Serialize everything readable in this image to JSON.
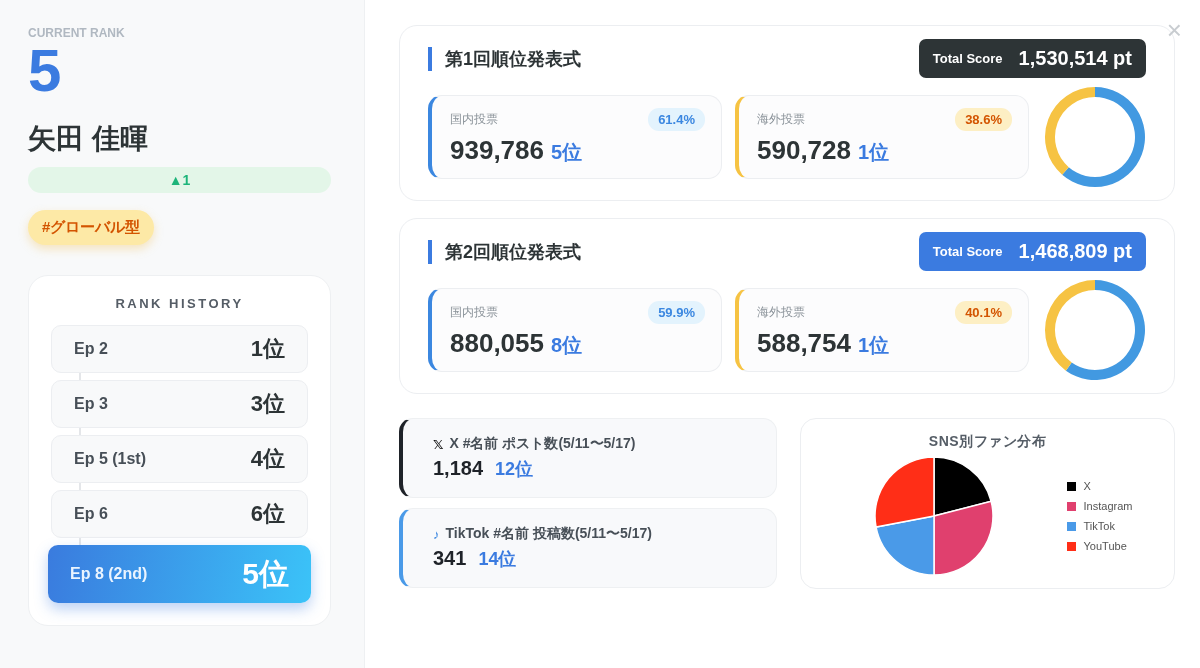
{
  "profile": {
    "label": "CURRENT RANK",
    "rank": "5",
    "name": "矢田 佳暉",
    "change": "▲1",
    "tag": "#グローバル型"
  },
  "history": {
    "title": "RANK HISTORY",
    "items": [
      {
        "episode": "Ep 2",
        "rank": "1位",
        "selected": false
      },
      {
        "episode": "Ep 3",
        "rank": "3位",
        "selected": false
      },
      {
        "episode": "Ep 5 (1st)",
        "rank": "4位",
        "selected": false
      },
      {
        "episode": "Ep 6",
        "rank": "6位",
        "selected": false
      },
      {
        "episode": "Ep 8 (2nd)",
        "rank": "5位",
        "selected": true
      }
    ]
  },
  "close": "×",
  "announcements": [
    {
      "title": "第1回順位発表式",
      "score": {
        "label": "Total Score",
        "value": "1,530,514 pt",
        "color": "#2d3436"
      },
      "votes": [
        {
          "kind": "domestic",
          "label": "国内投票",
          "share": "61.4%",
          "count": "939,786",
          "rank": "5位"
        },
        {
          "kind": "overseas",
          "label": "海外投票",
          "share": "38.6%",
          "count": "590,728",
          "rank": "1位"
        }
      ],
      "chart_data": {
        "type": "donut",
        "values": [
          61.4,
          38.6
        ]
      }
    },
    {
      "title": "第2回順位発表式",
      "score": {
        "label": "Total Score",
        "value": "1,468,809 pt",
        "color": "#3b7be0"
      },
      "votes": [
        {
          "kind": "domestic",
          "label": "国内投票",
          "share": "59.9%",
          "count": "880,055",
          "rank": "8位"
        },
        {
          "kind": "overseas",
          "label": "海外投票",
          "share": "40.1%",
          "count": "588,754",
          "rank": "1位"
        }
      ],
      "chart_data": {
        "type": "donut",
        "values": [
          59.9,
          40.1
        ]
      }
    }
  ],
  "sns_stats": [
    {
      "kind": "x",
      "icon": "𝕏",
      "label": "X #名前 ポスト数(5/11〜5/17)",
      "count": "1,184",
      "rank": "12位"
    },
    {
      "kind": "tiktok",
      "icon": "♪",
      "label": "TikTok #名前 投稿数(5/11〜5/17)",
      "count": "341",
      "rank": "14位"
    }
  ],
  "fan_distribution": {
    "title": "SNS別ファン分布",
    "legend": [
      {
        "label": "X",
        "color": "#000000"
      },
      {
        "label": "Instagram",
        "color": "#e0406e"
      },
      {
        "label": "TikTok",
        "color": "#4a9ae8"
      },
      {
        "label": "YouTube",
        "color": "#ff2e17"
      }
    ]
  }
}
